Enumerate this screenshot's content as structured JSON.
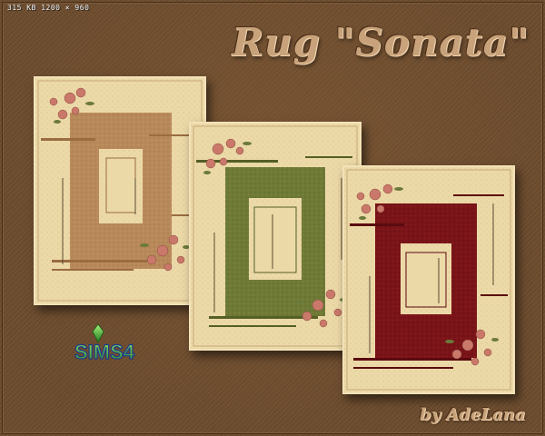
{
  "header": {
    "image_info": "315 KB 1200 × 960",
    "title": "Rug \"Sonata\""
  },
  "footer": {
    "byline": "by AdeLana"
  },
  "logo": {
    "text": "SIMS4"
  },
  "rugs": [
    {
      "name": "tan",
      "field_color": "#b8895a",
      "accent_color": "#9a6c40"
    },
    {
      "name": "green",
      "field_color": "#6f7a36",
      "accent_color": "#555f26"
    },
    {
      "name": "red",
      "field_color": "#7a1418",
      "accent_color": "#5a0b0f"
    }
  ],
  "colors": {
    "background": "#6e4c2d",
    "title_text": "#c8a27a",
    "rug_base": "#ecd9a8",
    "flower": "#c9786a"
  }
}
